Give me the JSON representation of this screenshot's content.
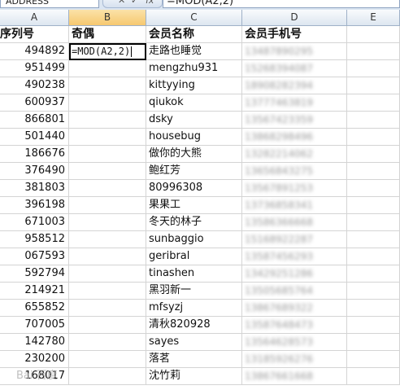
{
  "formula_bar": {
    "name_box": "ADDRESS",
    "cancel_glyph": "✕",
    "enter_glyph": "✓",
    "fx_glyph": "fx",
    "formula": "=MOD(A2,2)"
  },
  "columns": [
    "A",
    "B",
    "C",
    "D",
    "E"
  ],
  "selected_column": "B",
  "header_row": {
    "a": "序列号",
    "b": "奇偶",
    "c": "会员名称",
    "d": "会员手机号"
  },
  "active_cell": {
    "ref": "B2",
    "text": "=MOD(A2,2)"
  },
  "rows": [
    {
      "a": "494892",
      "b": "",
      "c": "走路也睡觉",
      "d": "13487890295"
    },
    {
      "a": "951499",
      "b": "",
      "c": "mengzhu931",
      "d": "15268394087"
    },
    {
      "a": "490238",
      "b": "",
      "c": "kittyying",
      "d": "18908282394"
    },
    {
      "a": "600937",
      "b": "",
      "c": "qiukok",
      "d": "13777463819"
    },
    {
      "a": "866801",
      "b": "",
      "c": "dsky",
      "d": "13567423359"
    },
    {
      "a": "501440",
      "b": "",
      "c": "housebug",
      "d": "13868298496"
    },
    {
      "a": "186676",
      "b": "",
      "c": "做你的大熊",
      "d": "13282214062"
    },
    {
      "a": "376490",
      "b": "",
      "c": "鲍红芳",
      "d": "13656843275"
    },
    {
      "a": "381803",
      "b": "",
      "c": "80996308",
      "d": "13567891253"
    },
    {
      "a": "396198",
      "b": "",
      "c": "果果工",
      "d": "13736858341"
    },
    {
      "a": "671003",
      "b": "",
      "c": "冬天的林子",
      "d": "13586366668"
    },
    {
      "a": "958512",
      "b": "",
      "c": "sunbaggio",
      "d": "15168922287"
    },
    {
      "a": "067593",
      "b": "",
      "c": "geribral",
      "d": "13587456293"
    },
    {
      "a": "592794",
      "b": "",
      "c": "tinashen",
      "d": "13429251286"
    },
    {
      "a": "214921",
      "b": "",
      "c": "黑羽新一",
      "d": "13505685764"
    },
    {
      "a": "655852",
      "b": "",
      "c": "mfsyzj",
      "d": "13867689322"
    },
    {
      "a": "707005",
      "b": "",
      "c": "清秋820928",
      "d": "13587648473"
    },
    {
      "a": "142780",
      "b": "",
      "c": "sayes",
      "d": "13564628573"
    },
    {
      "a": "230200",
      "b": "",
      "c": "落茗",
      "d": "13185926276"
    },
    {
      "a": "168017",
      "b": "",
      "c": "沈竹莉",
      "d": "13867661668"
    }
  ],
  "watermark": "Bai 百度"
}
